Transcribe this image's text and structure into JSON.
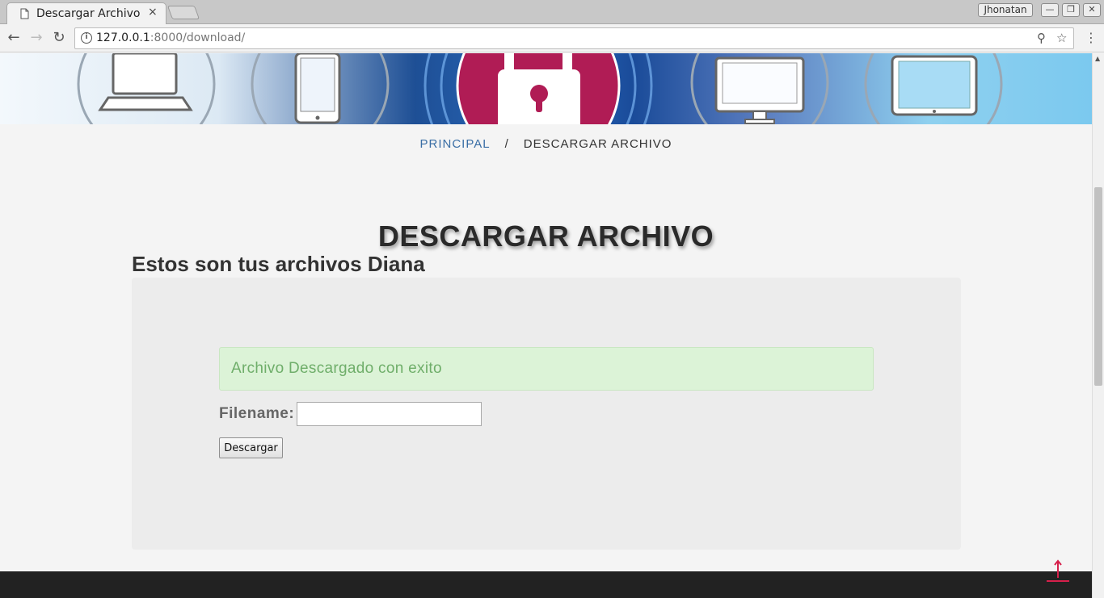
{
  "browser": {
    "tab_title": "Descargar Archivo",
    "tab_close": "×",
    "profile_name": "Jhonatan",
    "url_host": "127.0.0.1",
    "url_rest": ":8000/download/",
    "window_buttons": [
      "—",
      "❐",
      "✕"
    ]
  },
  "icons": {
    "back": "back-arrow-icon",
    "forward": "forward-arrow-icon",
    "reload": "reload-icon",
    "info": "info-icon",
    "zoom": "zoom-icon",
    "star": "bookmark-star-icon",
    "menu": "menu-dots-icon",
    "to_top": "arrow-up-icon"
  },
  "breadcrumb": {
    "home": "PRINCIPAL",
    "separator": "/",
    "current": "DESCARGAR ARCHIVO"
  },
  "page": {
    "title": "DESCARGAR ARCHIVO",
    "subtitle": "Estos son tus archivos Diana",
    "alert": "Archivo Descargado con exito",
    "filename_label": "Filename:",
    "filename_value": "",
    "submit_label": "Descargar"
  },
  "colors": {
    "link": "#3a6ea5",
    "alert_bg": "#dcf3d7",
    "alert_text": "#6fae6a",
    "footer": "#222222",
    "accent": "#d6204b"
  }
}
